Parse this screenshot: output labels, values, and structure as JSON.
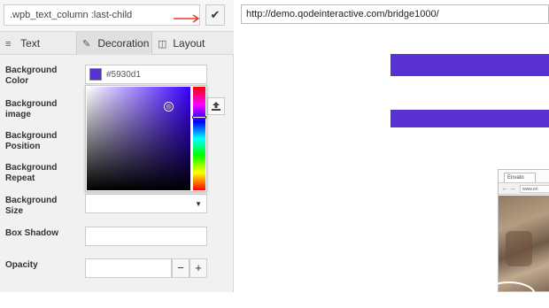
{
  "selector": {
    "value": ".wpb_text_column :last-child",
    "apply_icon": "✔"
  },
  "tabs": [
    {
      "label": "Text",
      "icon": "≡"
    },
    {
      "label": "Decoration",
      "icon": "✎"
    },
    {
      "label": "Layout",
      "icon": "◫"
    }
  ],
  "fields": {
    "background_color": {
      "label": "Background Color",
      "hex": "#5930d1",
      "swatch_color": "#5930d1"
    },
    "background_image": {
      "label": "Background image"
    },
    "background_position": {
      "label": "Background Position"
    },
    "background_repeat": {
      "label": "Background Repeat"
    },
    "background_size": {
      "label": "Background Size",
      "value": ""
    },
    "box_shadow": {
      "label": "Box Shadow",
      "value": ""
    },
    "opacity": {
      "label": "Opacity",
      "value": "",
      "minus": "−",
      "plus": "+"
    }
  },
  "browser": {
    "url": "http://demo.qodeinteractive.com/bridge1000/"
  },
  "mini_browser": {
    "tab_label": "Envato",
    "url": "www.en"
  },
  "colors": {
    "accent": "#5930d1",
    "arrow": "#e53935"
  }
}
